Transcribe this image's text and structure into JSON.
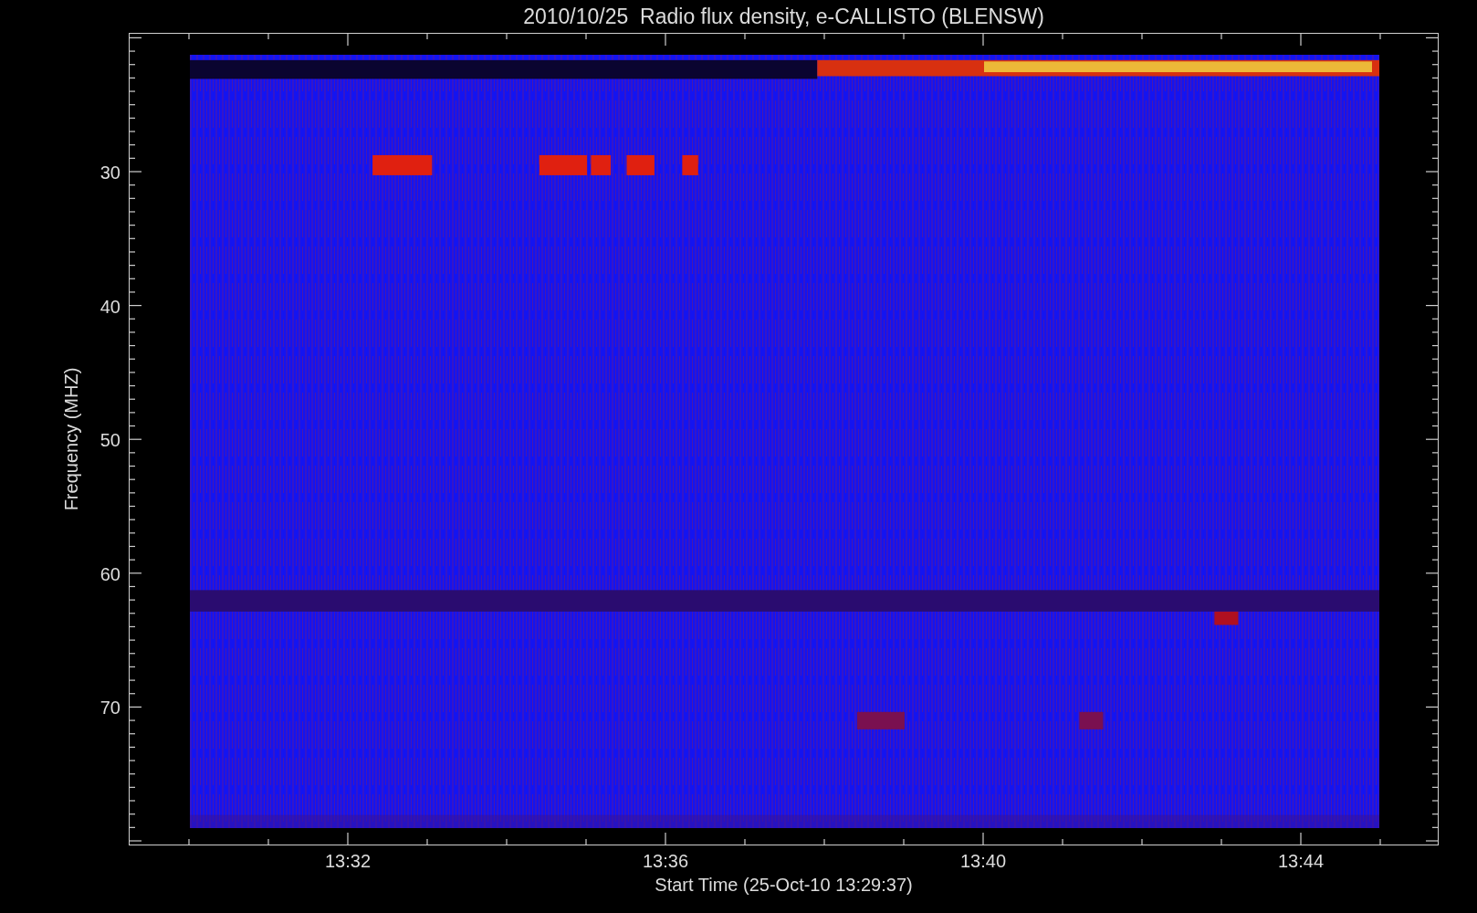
{
  "title": "2010/10/25  Radio flux density, e-CALLISTO (BLENSW)",
  "chart": {
    "xlabel": "Start Time (25-Oct-10 13:29:37)",
    "ylabel": "Frequency (MHZ)",
    "xticks": [
      "13:32",
      "13:36",
      "13:40",
      "13:44"
    ],
    "yticks": [
      "30",
      "40",
      "50",
      "60",
      "70"
    ]
  }
}
